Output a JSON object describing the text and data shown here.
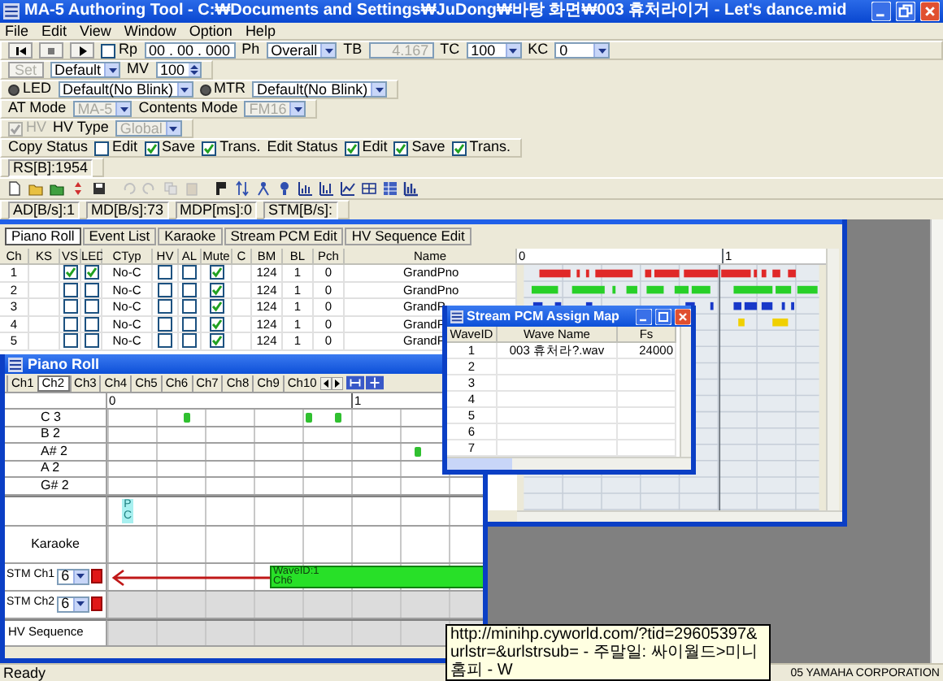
{
  "window": {
    "title": "MA-5 Authoring Tool - C:₩Documents and Settings₩JuDong₩바탕 화면₩003 휴처라이거 - Let's dance.mid"
  },
  "menu": [
    "File",
    "Edit",
    "View",
    "Window",
    "Option",
    "Help"
  ],
  "toolbar_rows": [
    {
      "kind": "band",
      "items": [
        {
          "kind": "first"
        },
        {
          "kind": "stop"
        },
        {
          "kind": "play"
        },
        {
          "kind": "check",
          "label": "Rp",
          "checked": false,
          "disabled": false
        },
        {
          "kind": "field",
          "value": "00 . 00 . 000",
          "disabled": false
        },
        {
          "kind": "label",
          "text": "Ph"
        },
        {
          "kind": "select",
          "value": "Overall",
          "disabled": false
        },
        {
          "kind": "label",
          "text": "TB"
        },
        {
          "kind": "field",
          "value": "4.167",
          "disabled": true
        },
        {
          "kind": "label",
          "text": "TC"
        },
        {
          "kind": "select",
          "value": "100",
          "disabled": false
        },
        {
          "kind": "label",
          "text": "KC"
        },
        {
          "kind": "select",
          "value": "0",
          "disabled": false
        }
      ]
    },
    {
      "kind": "band",
      "items": [
        {
          "kind": "button",
          "label": "Set",
          "disabled": true
        },
        {
          "kind": "select",
          "value": "Default",
          "disabled": false
        },
        {
          "kind": "label",
          "text": "MV"
        },
        {
          "kind": "spin",
          "value": "100"
        }
      ]
    },
    {
      "kind": "band",
      "items": [
        {
          "kind": "radio",
          "label": "LED",
          "selected": true
        },
        {
          "kind": "select",
          "value": "Default(No Blink)",
          "disabled": false
        },
        {
          "kind": "radio",
          "label": "MTR",
          "selected": true
        },
        {
          "kind": "select",
          "value": "Default(No Blink)",
          "disabled": false
        }
      ]
    },
    {
      "kind": "band",
      "items": [
        {
          "kind": "label",
          "text": "AT Mode"
        },
        {
          "kind": "select",
          "value": "MA-5",
          "disabled": true
        },
        {
          "kind": "label",
          "text": "Contents Mode"
        },
        {
          "kind": "select",
          "value": "FM16",
          "disabled": true
        }
      ]
    },
    {
      "kind": "band",
      "items": [
        {
          "kind": "check",
          "label": "HV",
          "checked": true,
          "disabled": true
        },
        {
          "kind": "label",
          "text": "HV Type"
        },
        {
          "kind": "select",
          "value": "Global",
          "disabled": true
        }
      ]
    },
    {
      "kind": "band",
      "items": [
        {
          "kind": "label",
          "text": "Copy Status"
        },
        {
          "kind": "check",
          "label": "Edit",
          "checked": false,
          "disabled": false
        },
        {
          "kind": "check",
          "label": "Save",
          "checked": true,
          "disabled": false
        },
        {
          "kind": "check",
          "label": "Trans.",
          "checked": true,
          "disabled": false
        },
        {
          "kind": "label",
          "text": "Edit Status"
        },
        {
          "kind": "check",
          "label": "Edit",
          "checked": true,
          "disabled": false
        },
        {
          "kind": "check",
          "label": "Save",
          "checked": true,
          "disabled": false
        },
        {
          "kind": "check",
          "label": "Trans.",
          "checked": true,
          "disabled": false
        }
      ]
    },
    {
      "kind": "band",
      "items": [
        {
          "kind": "readout",
          "text": "RS[B]:1954"
        }
      ]
    },
    {
      "kind": "icons"
    },
    {
      "kind": "band",
      "items": [
        {
          "kind": "readout",
          "text": "AD[B/s]:1"
        },
        {
          "kind": "readout",
          "text": "MD[B/s]:73"
        },
        {
          "kind": "readout",
          "text": "MDP[ms]:0"
        },
        {
          "kind": "readout",
          "text": "STM[B/s]:"
        }
      ]
    }
  ],
  "channel_window": {
    "tabs": [
      {
        "label": "Piano Roll",
        "selected": true
      },
      {
        "label": "Event List",
        "selected": false
      },
      {
        "label": "Karaoke",
        "selected": false
      },
      {
        "label": "Stream PCM Edit",
        "selected": false
      },
      {
        "label": "HV Sequence Edit",
        "selected": false
      }
    ],
    "columns": [
      "Ch",
      "KS",
      "VS",
      "LED",
      "CTyp",
      "HV",
      "AL",
      "Mute",
      "C",
      "BM",
      "BL",
      "Pch",
      "Name"
    ],
    "rows": [
      {
        "cells": [
          "1",
          null,
          true,
          true,
          "No-C",
          false,
          false,
          true,
          null,
          "124",
          "1",
          "0",
          "GrandPno"
        ]
      },
      {
        "cells": [
          "2",
          null,
          false,
          false,
          "No-C",
          false,
          false,
          true,
          null,
          "124",
          "1",
          "0",
          "GrandPno"
        ]
      },
      {
        "cells": [
          "3",
          null,
          false,
          false,
          "No-C",
          false,
          false,
          true,
          null,
          "124",
          "1",
          "0",
          "GrandP"
        ]
      },
      {
        "cells": [
          "4",
          null,
          false,
          false,
          "No-C",
          false,
          false,
          true,
          null,
          "124",
          "1",
          "0",
          "GrandP"
        ]
      },
      {
        "cells": [
          "5",
          null,
          false,
          false,
          "No-C",
          false,
          false,
          true,
          null,
          "124",
          "1",
          "0",
          "GrandP"
        ]
      }
    ],
    "ruler": [
      "0",
      "1"
    ]
  },
  "piano_roll": {
    "title": "Piano Roll",
    "channel_tabs": [
      {
        "label": "Ch1",
        "selected": false
      },
      {
        "label": "Ch2",
        "selected": true
      },
      {
        "label": "Ch3",
        "selected": false
      },
      {
        "label": "Ch4",
        "selected": false
      },
      {
        "label": "Ch5",
        "selected": false
      },
      {
        "label": "Ch6",
        "selected": false
      },
      {
        "label": "Ch7",
        "selected": false
      },
      {
        "label": "Ch8",
        "selected": false
      },
      {
        "label": "Ch9",
        "selected": false
      },
      {
        "label": "Ch10",
        "selected": false
      }
    ],
    "ruler": [
      "0",
      "1"
    ],
    "keys": [
      "C 3",
      "B 2",
      "A# 2",
      "A 2",
      "G# 2"
    ],
    "program_change_marker": "PC",
    "karaoke_label": "Karaoke",
    "stm_tracks": [
      {
        "label": "STM Ch1",
        "value": "6"
      },
      {
        "label": "STM Ch2",
        "value": "6"
      }
    ],
    "stream_event": [
      "WaveID:1",
      "Ch6"
    ],
    "hv_sequence_label": "HV Sequence"
  },
  "pcm_window": {
    "title": "Stream PCM Assign Map",
    "columns": [
      "WaveID",
      "Wave Name",
      "Fs"
    ],
    "rows": [
      {
        "id": "1",
        "name": "003 휴처라?.wav",
        "fs": "24000"
      },
      {
        "id": "2"
      },
      {
        "id": "3"
      },
      {
        "id": "4"
      },
      {
        "id": "5"
      },
      {
        "id": "6"
      },
      {
        "id": "7"
      }
    ]
  },
  "tooltip": {
    "text": "http://minihp.cyworld.com/?tid=29605397&urlstr=&urlstrsub= - 주말일: 싸이월드>미니홈피 - W"
  },
  "status_bar": {
    "text": "Ready",
    "copyright": "05 YAMAHA CORPORATION"
  }
}
